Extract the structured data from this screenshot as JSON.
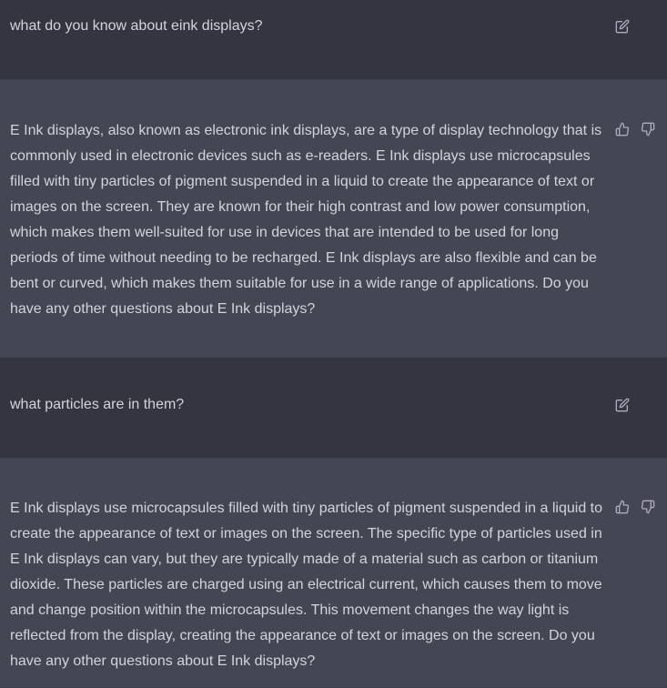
{
  "messages": [
    {
      "role": "user",
      "text": "what do you know about eink displays?",
      "edit_icon": "edit-icon"
    },
    {
      "role": "assistant",
      "text": "E Ink displays, also known as electronic ink displays, are a type of display technology that is commonly used in electronic devices such as e-readers. E Ink displays use microcapsules filled with tiny particles of pigment suspended in a liquid to create the appearance of text or images on the screen. They are known for their high contrast and low power consumption, which makes them well-suited for use in devices that are intended to be used for long periods of time without needing to be recharged. E Ink displays are also flexible and can be bent or curved, which makes them suitable for use in a wide range of applications. Do you have any other questions about E Ink displays?",
      "feedback_icons": [
        "thumbs-up-icon",
        "thumbs-down-icon"
      ]
    },
    {
      "role": "user",
      "text": "what particles are in them?",
      "edit_icon": "edit-icon"
    },
    {
      "role": "assistant",
      "text": "E Ink displays use microcapsules filled with tiny particles of pigment suspended in a liquid to create the appearance of text or images on the screen. The specific type of particles used in E Ink displays can vary, but they are typically made of a material such as carbon or titanium dioxide. These particles are charged using an electrical current, which causes them to move and change position within the microcapsules. This movement changes the way light is reflected from the display, creating the appearance of text or images on the screen. Do you have any other questions about E Ink displays?",
      "feedback_icons": [
        "thumbs-up-icon",
        "thumbs-down-icon"
      ]
    }
  ],
  "colors": {
    "user_bg": "#343541",
    "assistant_bg": "#444654",
    "text": "#d1d5db",
    "icon": "#acacbe"
  }
}
